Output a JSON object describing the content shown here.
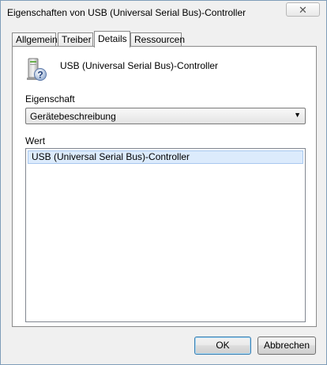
{
  "window": {
    "title": "Eigenschaften von USB (Universal Serial Bus)-Controller",
    "close_glyph": "✕"
  },
  "tabs": [
    {
      "label": "Allgemein",
      "active": false
    },
    {
      "label": "Treiber",
      "active": false
    },
    {
      "label": "Details",
      "active": true
    },
    {
      "label": "Ressourcen",
      "active": false
    }
  ],
  "device": {
    "icon": "usb-device-unknown-icon",
    "name": "USB (Universal Serial Bus)-Controller"
  },
  "property": {
    "label": "Eigenschaft",
    "selected": "Gerätebeschreibung"
  },
  "value": {
    "label": "Wert",
    "items": [
      "USB (Universal Serial Bus)-Controller"
    ]
  },
  "buttons": {
    "ok": "OK",
    "cancel": "Abbrechen"
  },
  "colors": {
    "dialog_bg": "#f0f0f0",
    "selection_bg": "#dcebfc",
    "selection_border": "#a8c8ef"
  }
}
